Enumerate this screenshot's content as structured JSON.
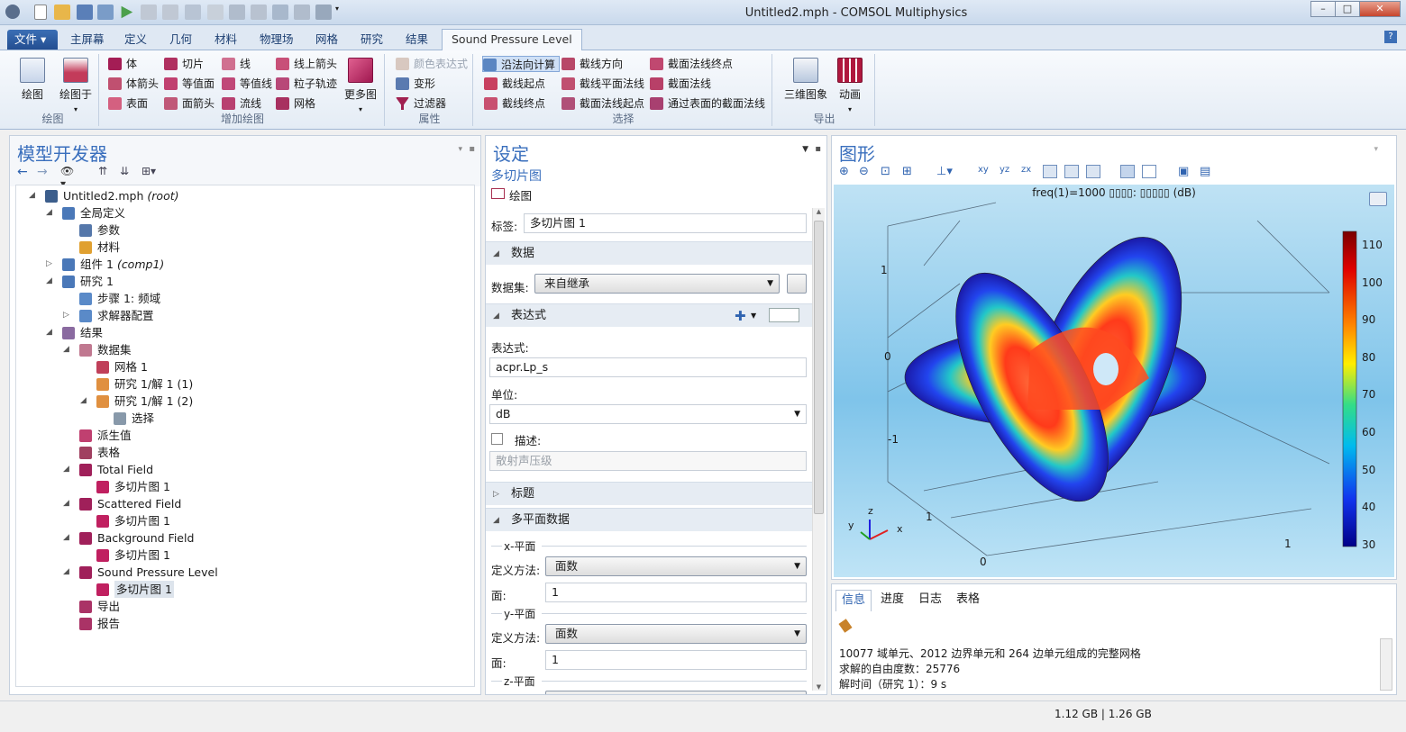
{
  "window": {
    "title": "Untitled2.mph - COMSOL Multiphysics",
    "min": "–",
    "max": "□",
    "close": "✕"
  },
  "tabs": {
    "file": "文件 ▾",
    "items": [
      "主屏幕",
      "定义",
      "几何",
      "材料",
      "物理场",
      "网格",
      "研究",
      "结果"
    ],
    "active": "Sound Pressure Level",
    "help": "?"
  },
  "ribbon": {
    "plot_group": {
      "label": "绘图",
      "plot": "绘图",
      "plot_in": "绘图于"
    },
    "add_plot": {
      "label": "增加绘图",
      "items": [
        "体",
        "体箭头",
        "表面",
        "切片",
        "等值面",
        "面箭头",
        "线",
        "等值线",
        "流线",
        "线上箭头",
        "粒子轨迹",
        "网格"
      ],
      "more": "更多图"
    },
    "attributes": {
      "label": "属性",
      "items": [
        "颜色表达式",
        "变形",
        "过滤器"
      ]
    },
    "select": {
      "label": "选择",
      "items": [
        "沿法向计算",
        "截线起点",
        "截线终点",
        "截线方向",
        "截线平面法线",
        "截面法线起点",
        "截面法线终点",
        "截面法线",
        "通过表面的截面法线"
      ]
    },
    "export": {
      "label": "导出",
      "items": [
        "三维图象",
        "动画"
      ]
    }
  },
  "model_builder": {
    "title": "模型开发器",
    "tree": [
      {
        "label": "Untitled2.mph",
        "suffix": "(root)",
        "level": 0,
        "toggle": "◢",
        "icon": "diamond-icon",
        "color": "#3c5e8c"
      },
      {
        "label": "全局定义",
        "level": 1,
        "toggle": "◢",
        "icon": "globe-icon",
        "color": "#4a78b8"
      },
      {
        "label": "参数",
        "level": 2,
        "toggle": "",
        "icon": "parameter-icon",
        "color": "#5577aa"
      },
      {
        "label": "材料",
        "level": 2,
        "toggle": "",
        "icon": "material-icon",
        "color": "#e0a030"
      },
      {
        "label": "组件 1",
        "suffix": "(comp1)",
        "level": 1,
        "toggle": "▷",
        "icon": "component-icon",
        "color": "#4a78b8"
      },
      {
        "label": "研究 1",
        "level": 1,
        "toggle": "◢",
        "icon": "study-icon",
        "color": "#4a78b8"
      },
      {
        "label": "步骤 1: 频域",
        "level": 2,
        "toggle": "",
        "icon": "step-icon",
        "color": "#5a8ac8"
      },
      {
        "label": "求解器配置",
        "level": 2,
        "toggle": "▷",
        "icon": "solver-icon",
        "color": "#5a8ac8"
      },
      {
        "label": "结果",
        "level": 1,
        "toggle": "◢",
        "icon": "results-icon",
        "color": "#8a6aa0"
      },
      {
        "label": "数据集",
        "level": 2,
        "toggle": "◢",
        "icon": "dataset-icon",
        "color": "#c07890"
      },
      {
        "label": "网格 1",
        "level": 3,
        "toggle": "",
        "icon": "mesh-icon",
        "color": "#c0405a"
      },
      {
        "label": "研究 1/解 1 (1)",
        "level": 3,
        "toggle": "",
        "icon": "solution-icon",
        "color": "#e09040"
      },
      {
        "label": "研究 1/解 1 (2)",
        "level": 3,
        "toggle": "◢",
        "icon": "solution-icon",
        "color": "#e09040"
      },
      {
        "label": "选择",
        "level": 4,
        "toggle": "",
        "icon": "selection-icon",
        "color": "#8899aa"
      },
      {
        "label": "派生值",
        "level": 2,
        "toggle": "",
        "icon": "derived-values-icon",
        "color": "#c04070"
      },
      {
        "label": "表格",
        "level": 2,
        "toggle": "",
        "icon": "table-icon",
        "color": "#a04060"
      },
      {
        "label": "Total Field",
        "level": 2,
        "toggle": "◢",
        "icon": "plot-group-icon",
        "color": "#a0205a"
      },
      {
        "label": "多切片图 1",
        "level": 3,
        "toggle": "",
        "icon": "multislice-icon",
        "color": "#c02060"
      },
      {
        "label": "Scattered Field",
        "level": 2,
        "toggle": "◢",
        "icon": "plot-group-icon",
        "color": "#a0205a"
      },
      {
        "label": "多切片图 1",
        "level": 3,
        "toggle": "",
        "icon": "multislice-icon",
        "color": "#c02060"
      },
      {
        "label": "Background Field",
        "level": 2,
        "toggle": "◢",
        "icon": "plot-group-icon",
        "color": "#a0205a"
      },
      {
        "label": "多切片图 1",
        "level": 3,
        "toggle": "",
        "icon": "multislice-icon",
        "color": "#c02060"
      },
      {
        "label": "Sound Pressure Level",
        "level": 2,
        "toggle": "◢",
        "icon": "plot-group-icon",
        "color": "#a0205a"
      },
      {
        "label": "多切片图 1",
        "level": 3,
        "toggle": "",
        "icon": "multislice-icon",
        "color": "#c02060",
        "selected": true
      },
      {
        "label": "导出",
        "level": 2,
        "toggle": "",
        "icon": "export-icon",
        "color": "#aa3366"
      },
      {
        "label": "报告",
        "level": 2,
        "toggle": "",
        "icon": "report-icon",
        "color": "#aa3366"
      }
    ]
  },
  "settings": {
    "title": "设定",
    "subtitle": "多切片图",
    "plot_button": "绘图",
    "label_caption": "标签:",
    "label_value": "多切片图 1",
    "sec_data": "数据",
    "dataset_caption": "数据集:",
    "dataset_value": "来自继承",
    "sec_expression": "表达式",
    "expr_caption": "表达式:",
    "expr_value": "acpr.Lp_s",
    "unit_caption": "单位:",
    "unit_value": "dB",
    "desc_caption": "描述:",
    "desc_value": "散射声压级",
    "sec_title": "标题",
    "sec_multiplane": "多平面数据",
    "x_plane": "x-平面",
    "y_plane": "y-平面",
    "z_plane": "z-平面",
    "method_caption": "定义方法:",
    "method_value": "面数",
    "planes_caption": "面:",
    "x_planes": "1",
    "y_planes": "1"
  },
  "graphics": {
    "title": "图形",
    "plot_title": "freq(1)=1000   ▯▯▯▯: ▯▯▯▯▯ (dB)",
    "axis_labels": [
      "1",
      "0",
      "-1",
      "1",
      "0",
      "1"
    ],
    "triad": {
      "x": "x",
      "y": "y",
      "z": "z"
    },
    "colorbar_ticks": [
      "110",
      "100",
      "90",
      "80",
      "70",
      "60",
      "50",
      "40",
      "30"
    ]
  },
  "messages": {
    "tabs": [
      "信息",
      "进度",
      "日志",
      "表格"
    ],
    "lines": [
      "10077 域单元、2012 边界单元和 264 边单元组成的完整网格",
      "求解的自由度数：25776",
      "解时间（研究 1）：9 s"
    ]
  },
  "status": {
    "memory": "1.12 GB | 1.26 GB"
  }
}
